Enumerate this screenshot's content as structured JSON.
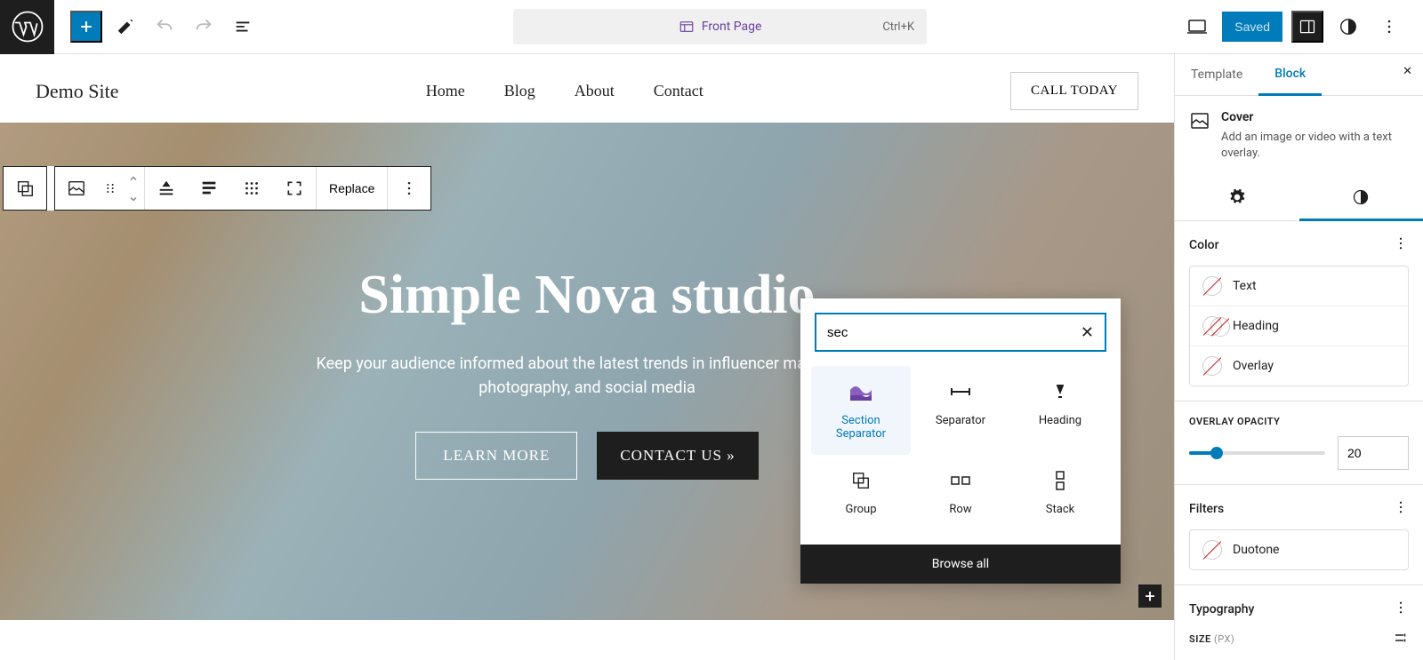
{
  "toolbar": {
    "page_label": "Front Page",
    "shortcut": "Ctrl+K",
    "saved": "Saved"
  },
  "block_toolbar": {
    "replace": "Replace"
  },
  "site": {
    "title": "Demo Site",
    "nav": [
      "Home",
      "Blog",
      "About",
      "Contact"
    ],
    "cta": "CALL TODAY"
  },
  "cover": {
    "heading": "Simple Nova studio",
    "subheading": "Keep your audience informed about the latest trends in influencer marketing, photography, and social media",
    "btn1": "LEARN MORE",
    "btn2": "CONTACT US »"
  },
  "inserter": {
    "search_value": "sec",
    "browse": "Browse all",
    "items": [
      {
        "label": "Section Separator",
        "icon": "section-separator",
        "selected": true
      },
      {
        "label": "Separator",
        "icon": "separator"
      },
      {
        "label": "Heading",
        "icon": "heading"
      },
      {
        "label": "Group",
        "icon": "group"
      },
      {
        "label": "Row",
        "icon": "row"
      },
      {
        "label": "Stack",
        "icon": "stack"
      }
    ]
  },
  "sidebar": {
    "tabs": [
      "Template",
      "Block"
    ],
    "active_tab": "Block",
    "block_name": "Cover",
    "block_desc": "Add an image or video with a text overlay.",
    "panels": {
      "color": {
        "title": "Color",
        "items": [
          "Text",
          "Heading",
          "Overlay"
        ]
      },
      "overlay_opacity": {
        "label": "OVERLAY OPACITY",
        "value": "20",
        "percent": 20
      },
      "filters": {
        "title": "Filters",
        "items": [
          "Duotone"
        ]
      },
      "typography": {
        "title": "Typography",
        "size_label": "SIZE",
        "size_unit": "(PX)"
      }
    }
  }
}
